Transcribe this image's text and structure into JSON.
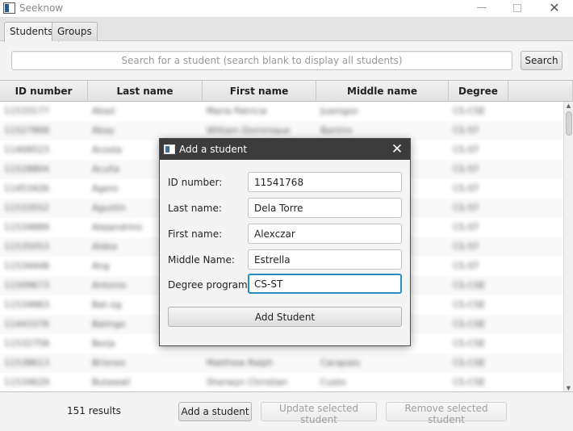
{
  "window": {
    "title": "Seeknow"
  },
  "tabs": [
    {
      "label": "Students",
      "active": true
    },
    {
      "label": "Groups",
      "active": false
    }
  ],
  "search": {
    "placeholder": "Search for a student (search blank to display all students)",
    "button_label": "Search"
  },
  "table": {
    "columns": [
      "ID number",
      "Last name",
      "First name",
      "Middle name",
      "Degree"
    ],
    "rows": [
      [
        "11533177",
        "Abad",
        "Maria Patricia",
        "Juanigos",
        "CS-CSE"
      ],
      [
        "11527868",
        "Abay",
        "William Dominique",
        "Bantiro",
        "CS-ST"
      ],
      [
        "11408523",
        "Acosta",
        "",
        "",
        "CS-ST"
      ],
      [
        "11528804",
        "Acuña",
        "",
        "",
        "CS-ST"
      ],
      [
        "11453426",
        "Agero",
        "",
        "",
        "CS-ST"
      ],
      [
        "11533552",
        "Agustin",
        "",
        "",
        "CS-ST"
      ],
      [
        "11534889",
        "Alejandrino",
        "",
        "",
        "CS-ST"
      ],
      [
        "11535053",
        "Aldea",
        "",
        "",
        "CS-ST"
      ],
      [
        "11534448",
        "Ang",
        "",
        "",
        "CS-ST"
      ],
      [
        "11509673",
        "Antonio",
        "",
        "",
        "CS-CSE"
      ],
      [
        "11534863",
        "Bat-og",
        "",
        "",
        "CS-CSE"
      ],
      [
        "11443376",
        "Balingo",
        "",
        "",
        "CS-CSE"
      ],
      [
        "11532758",
        "Borja",
        "",
        "",
        "CS-CSE"
      ],
      [
        "11538613",
        "Briones",
        "Matthew Ralph",
        "Carapalo",
        "CS-CSE"
      ],
      [
        "11534629",
        "Butawali",
        "Sherwyn Christian",
        "Custo",
        "CS-CSE"
      ]
    ]
  },
  "footer": {
    "results": "151 results",
    "add_label": "Add a student",
    "update_label": "Update selected student",
    "remove_label": "Remove selected student"
  },
  "dialog": {
    "title": "Add a student",
    "fields": [
      {
        "label": "ID number:",
        "value": "11541768"
      },
      {
        "label": "Last name:",
        "value": "Dela Torre"
      },
      {
        "label": "First name:",
        "value": "Alexczar"
      },
      {
        "label": "Middle Name:",
        "value": "Estrella"
      },
      {
        "label": "Degree program:",
        "value": "CS-ST"
      }
    ],
    "submit_label": "Add Student"
  },
  "colors": {
    "focus_border": "#2b8cc4",
    "dialog_titlebar": "#3c3c3c"
  }
}
